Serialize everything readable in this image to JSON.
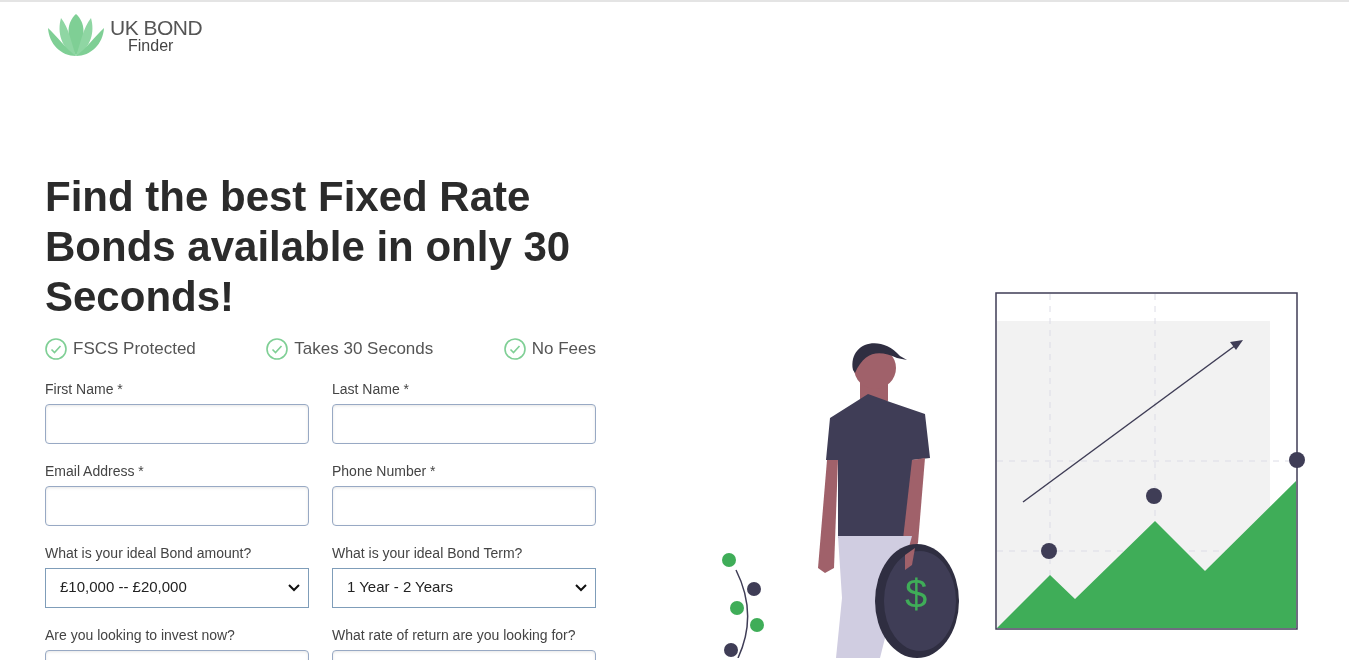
{
  "logo": {
    "line_1": "UK BOND",
    "line_2": "Finder"
  },
  "heading": "Find the best Fixed Rate Bonds available in only 30 Seconds!",
  "features": [
    {
      "label": "FSCS Protected"
    },
    {
      "label": "Takes 30 Seconds"
    },
    {
      "label": "No Fees"
    }
  ],
  "form": {
    "fields": [
      {
        "kind": "text",
        "label": "First Name *"
      },
      {
        "kind": "text",
        "label": "Last Name *"
      },
      {
        "kind": "text",
        "label": "Email Address *"
      },
      {
        "kind": "text",
        "label": "Phone Number *"
      },
      {
        "kind": "select",
        "label": "What is your ideal Bond amount?",
        "value": "£10,000 -- £20,000"
      },
      {
        "kind": "select",
        "label": "What is your ideal Bond Term?",
        "value": "1 Year - 2 Years"
      },
      {
        "kind": "text",
        "label": "Are you looking to invest now?"
      },
      {
        "kind": "text",
        "label": "What rate of return are you looking for?"
      }
    ]
  },
  "illustration": {
    "coin_symbol": "$"
  }
}
